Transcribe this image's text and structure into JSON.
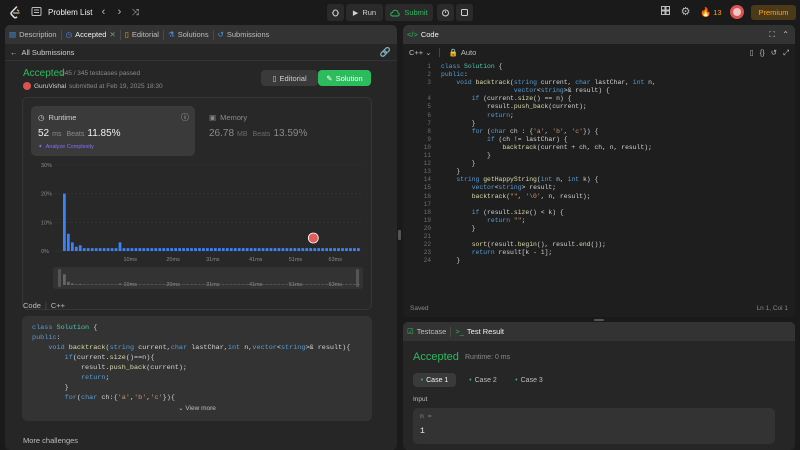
{
  "topbar": {
    "problem_list": "Problem List",
    "run_label": "Run",
    "submit_label": "Submit",
    "streak_count": "13",
    "premium_label": "Premium"
  },
  "left_tabs": [
    {
      "label": "Description"
    },
    {
      "label": "Accepted"
    },
    {
      "label": "Editorial"
    },
    {
      "label": "Solutions"
    },
    {
      "label": "Submissions"
    }
  ],
  "submission": {
    "back_label": "All Submissions",
    "status": "Accepted",
    "testcases": "345 / 345 testcases passed",
    "user": "GuruVishal",
    "submitted_at": "submitted at Feb 19, 2025 18:30",
    "editorial_btn": "Editorial",
    "solution_btn": "Solution",
    "runtime_label": "Runtime",
    "runtime_value": "52",
    "runtime_unit": "ms",
    "beats_label": "Beats",
    "runtime_beats": "11.85%",
    "analyze_label": "Analyze Complexity",
    "memory_label": "Memory",
    "memory_value": "26.78",
    "memory_unit": "MB",
    "memory_beats": "13.59%"
  },
  "chart_data": {
    "type": "bar",
    "y_ticks": [
      "30%",
      "20%",
      "10%",
      "0%"
    ],
    "ylim": [
      0,
      30
    ],
    "x_ticks": [
      "10ms",
      "20ms",
      "31ms",
      "41ms",
      "51ms",
      "63ms"
    ],
    "values": [
      20,
      6,
      3,
      1.5,
      2,
      1,
      1,
      1,
      1,
      1,
      1,
      1,
      1,
      1,
      3,
      1,
      1,
      1,
      1,
      1,
      1,
      1,
      1,
      1,
      1,
      1,
      1,
      1,
      1,
      1,
      1,
      1,
      1,
      1,
      1,
      1,
      1,
      1,
      1,
      1,
      1,
      1,
      1,
      1,
      1,
      1,
      1,
      1,
      1,
      1,
      1,
      1,
      1,
      1,
      1,
      1,
      1,
      1,
      1,
      1,
      1,
      1,
      1,
      1,
      1,
      1,
      1,
      1,
      1,
      1,
      1,
      1,
      1,
      1,
      1
    ],
    "brush_ticks": [
      "10ms",
      "20ms",
      "31ms",
      "41ms",
      "51ms",
      "63ms"
    ]
  },
  "code_preview": {
    "header": "Code",
    "lang": "C++",
    "lines": [
      "class Solution {",
      "public:",
      "    void backtrack(string current,char lastChar,int n,vector<string>& result){",
      "        if(current.size()==n){",
      "            result.push_back(current);",
      "            return;",
      "        }",
      "        for(char ch:{'a','b','c'}){"
    ],
    "view_more": "View more",
    "more_challenges": "More challenges"
  },
  "editor": {
    "title": "Code",
    "lang": "C++",
    "mode": "Auto",
    "lines": [
      "class Solution {",
      "public:",
      "    void backtrack(string current, char lastChar, int n,",
      "                   vector<string>& result) {",
      "        if (current.size() == n) {",
      "            result.push_back(current);",
      "            return;",
      "        }",
      "        for (char ch : {'a', 'b', 'c'}) {",
      "            if (ch != lastChar) {",
      "                backtrack(current + ch, ch, n, result);",
      "            }",
      "        }",
      "    }",
      "    string getHappyString(int n, int k) {",
      "        vector<string> result;",
      "        backtrack(\"\", '\\0', n, result);",
      "",
      "        if (result.size() < k) {",
      "            return \"\";",
      "        }",
      "",
      "        sort(result.begin(), result.end());",
      "        return result[k - 1];",
      "    }"
    ],
    "line_numbers": [
      "1",
      "2",
      "3",
      "",
      "4",
      "5",
      "6",
      "7",
      "8",
      "9",
      "10",
      "11",
      "12",
      "13",
      "14",
      "15",
      "16",
      "17",
      "18",
      "19",
      "20",
      "21",
      "22",
      "23",
      "24"
    ],
    "saved": "Saved",
    "cursor": "Ln 1, Col 1"
  },
  "result": {
    "testcase_tab": "Testcase",
    "result_tab": "Test Result",
    "status": "Accepted",
    "runtime": "Runtime: 0 ms",
    "cases": [
      "Case 1",
      "Case 2",
      "Case 3"
    ],
    "input_label": "Input",
    "var_name": "n =",
    "var_value": "1"
  }
}
